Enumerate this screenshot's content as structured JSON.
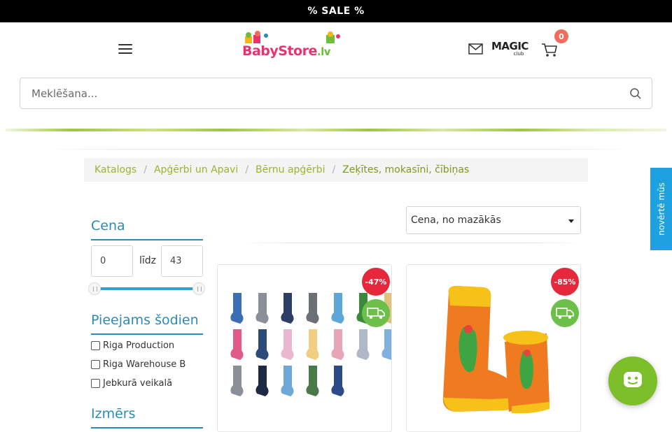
{
  "topbar": {
    "text": "% SALE %"
  },
  "header": {
    "logo_text": "BabyStore",
    "logo_suffix": ".lv",
    "magic_word": "MAGIC",
    "magic_sub": "club",
    "cart_count": "0"
  },
  "search": {
    "placeholder": "Meklēšana..."
  },
  "breadcrumb": {
    "items": [
      "Katalogs",
      "Apģērbi un Apavi",
      "Bērnu apģērbi"
    ],
    "active": "Zeķītes, mokasīni, čībiņas"
  },
  "filters": {
    "price": {
      "title": "Cena",
      "min": "0",
      "max": "43",
      "to_label": "līdz"
    },
    "availability": {
      "title": "Pieejams šodien",
      "options": [
        "Riga Production",
        "Riga Warehouse B",
        "Jebkurā veikalā"
      ]
    },
    "size": {
      "title": "Izmērs"
    }
  },
  "sort": {
    "selected": "Cena, no mazākās"
  },
  "products": [
    {
      "discount": "-47%"
    },
    {
      "discount": "-85%"
    }
  ],
  "rate_tab": {
    "label": "novērtē mūs"
  },
  "colors": {
    "accent_blue": "#2b8bb5",
    "breadcrumb_green": "#9ab432",
    "sale_red": "#e6283c",
    "truck_green": "#6cc04a",
    "chat_green": "#7dbf2a",
    "rate_blue": "#1da1e0"
  },
  "icons": [
    "hamburger-icon",
    "mail-icon",
    "cart-icon",
    "search-icon",
    "truck-icon",
    "chat-icon"
  ]
}
